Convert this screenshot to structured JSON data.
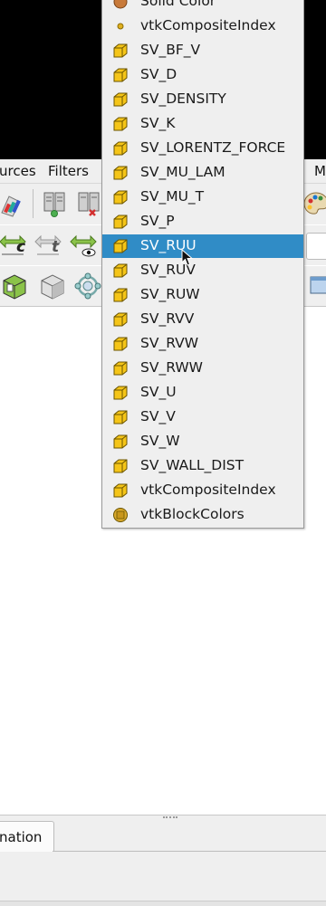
{
  "menubar": {
    "sources_label": "urces",
    "filters_label": "Filters",
    "macros_label": "M"
  },
  "dropdown": {
    "items": [
      {
        "label": "Solid Color",
        "icon": "solid-color-icon",
        "selected": false
      },
      {
        "label": "vtkCompositeIndex",
        "icon": "point-data-icon",
        "selected": false
      },
      {
        "label": "SV_BF_V",
        "icon": "cell-data-icon",
        "selected": false
      },
      {
        "label": "SV_D",
        "icon": "cell-data-icon",
        "selected": false
      },
      {
        "label": "SV_DENSITY",
        "icon": "cell-data-icon",
        "selected": false
      },
      {
        "label": "SV_K",
        "icon": "cell-data-icon",
        "selected": false
      },
      {
        "label": "SV_LORENTZ_FORCE",
        "icon": "cell-data-icon",
        "selected": false
      },
      {
        "label": "SV_MU_LAM",
        "icon": "cell-data-icon",
        "selected": false
      },
      {
        "label": "SV_MU_T",
        "icon": "cell-data-icon",
        "selected": false
      },
      {
        "label": "SV_P",
        "icon": "cell-data-icon",
        "selected": false
      },
      {
        "label": "SV_RUU",
        "icon": "cell-data-icon",
        "selected": true
      },
      {
        "label": "SV_RUV",
        "icon": "cell-data-icon",
        "selected": false
      },
      {
        "label": "SV_RUW",
        "icon": "cell-data-icon",
        "selected": false
      },
      {
        "label": "SV_RVV",
        "icon": "cell-data-icon",
        "selected": false
      },
      {
        "label": "SV_RVW",
        "icon": "cell-data-icon",
        "selected": false
      },
      {
        "label": "SV_RWW",
        "icon": "cell-data-icon",
        "selected": false
      },
      {
        "label": "SV_U",
        "icon": "cell-data-icon",
        "selected": false
      },
      {
        "label": "SV_V",
        "icon": "cell-data-icon",
        "selected": false
      },
      {
        "label": "SV_W",
        "icon": "cell-data-icon",
        "selected": false
      },
      {
        "label": "SV_WALL_DIST",
        "icon": "cell-data-icon",
        "selected": false
      },
      {
        "label": "vtkCompositeIndex",
        "icon": "cell-data-icon",
        "selected": false
      },
      {
        "label": "vtkBlockColors",
        "icon": "field-data-icon",
        "selected": false
      }
    ]
  },
  "toolbar2": {
    "btn1_glyph": "c",
    "btn2_glyph": "t"
  },
  "bottom": {
    "tab_label": "nation"
  },
  "colors": {
    "selection": "#308cc6",
    "cell_icon": "#f5c518",
    "toolbar_bg": "#efefef"
  }
}
